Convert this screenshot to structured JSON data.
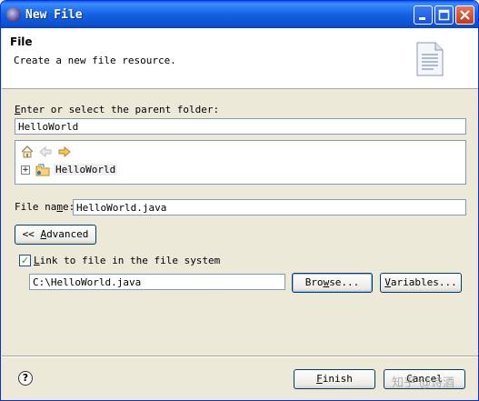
{
  "window": {
    "title": "New File"
  },
  "header": {
    "title": "File",
    "description": "Create a new file resource."
  },
  "parent": {
    "label_accel": "E",
    "label_rest": "nter or select the parent folder:",
    "value": "HelloWorld",
    "tree": {
      "items": [
        {
          "label": "HelloWorld"
        }
      ]
    }
  },
  "filename": {
    "label_pre": "File na",
    "label_accel": "m",
    "label_post": "e:",
    "value": "HelloWorld.java"
  },
  "advanced": {
    "prefix": "<< ",
    "accel": "A",
    "rest": "dvanced"
  },
  "link": {
    "checked": true,
    "check_glyph": "✓",
    "label_accel": "L",
    "label_rest": "ink to file in the file system",
    "path": "C:\\HelloWorld.java",
    "browse_accel": "w",
    "browse_pre": "Bro",
    "browse_post": "se...",
    "variables_accel": "V",
    "variables_rest": "ariables..."
  },
  "footer": {
    "help_glyph": "?",
    "finish_accel": "F",
    "finish_rest": "inish",
    "cancel_label": "Cancel",
    "watermark": "知乎 @诗酒"
  }
}
